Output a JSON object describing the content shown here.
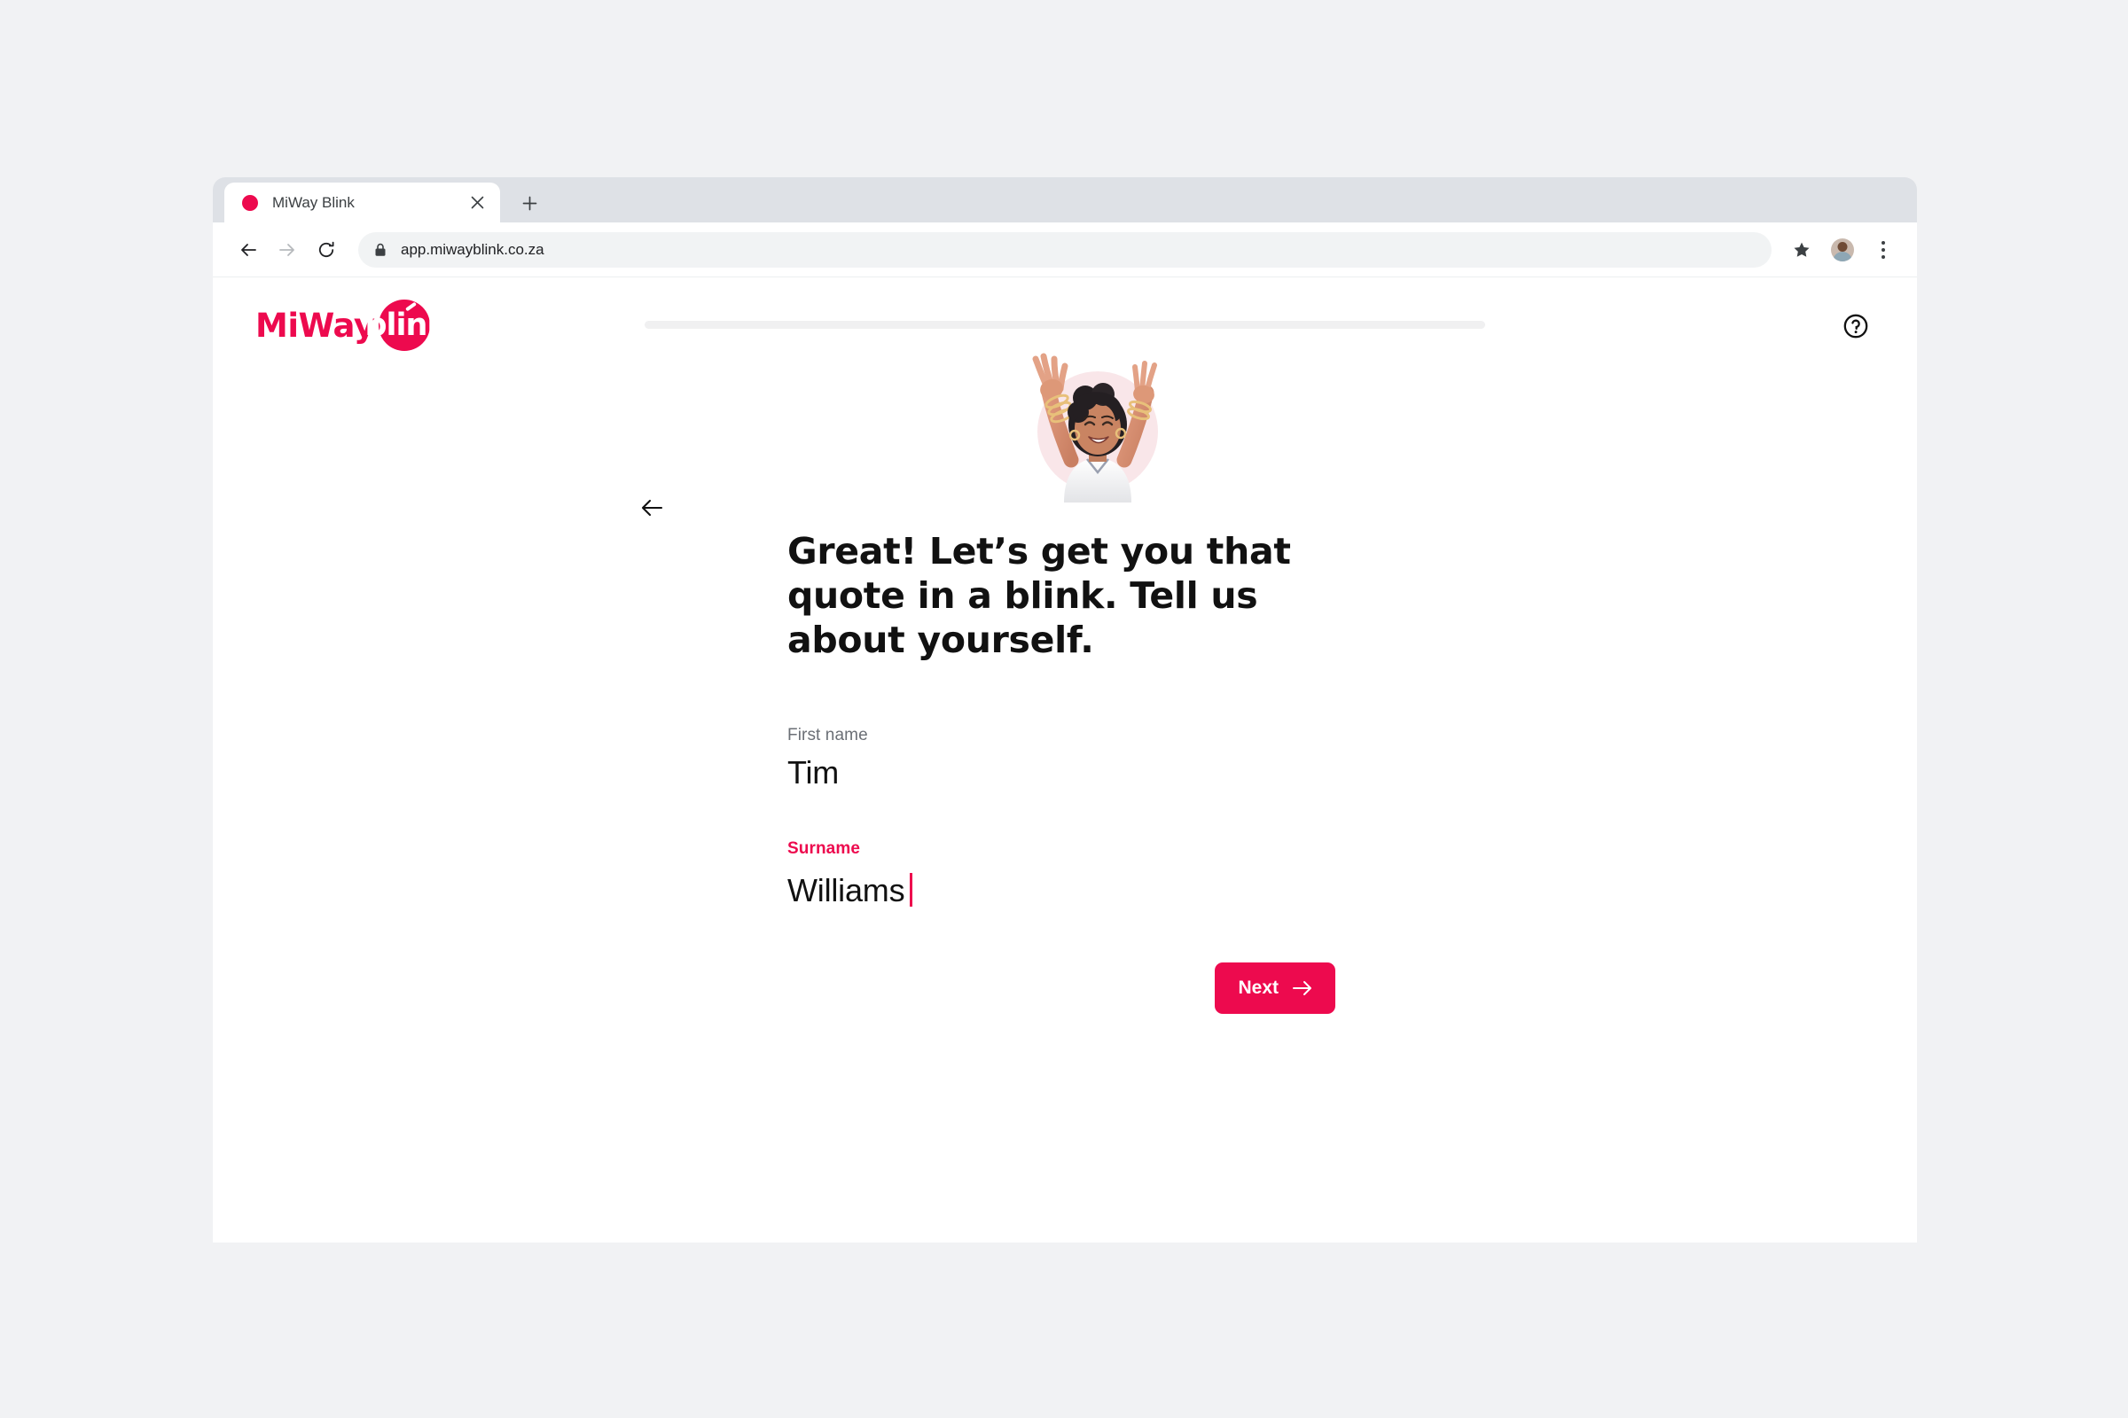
{
  "browser": {
    "tab": {
      "title": "MiWay Blink",
      "favicon_name": "miway-favicon",
      "close_label": "×"
    },
    "new_tab_label": "+",
    "toolbar": {
      "back_label": "←",
      "forward_label": "→",
      "reload_label": "⟳",
      "url": "app.miwayblink.co.za",
      "lock_name": "lock-icon",
      "bookmark_name": "star-icon",
      "profile_name": "profile-avatar",
      "menu_name": "kebab-menu-icon"
    }
  },
  "page": {
    "brand": {
      "word_one": "MiWay",
      "word_two": "blink"
    },
    "progress": {
      "percent": 0,
      "label": "0%"
    },
    "help_label": "?",
    "back_label": "←",
    "hero_name": "celebrating-woman-illustration",
    "headline": "Great! Let’s get you that quote in a blink. Tell us about yourself.",
    "fields": [
      {
        "id": "first-name",
        "label": "First name",
        "value": "Tim",
        "placeholder": "First name",
        "active": false
      },
      {
        "id": "surname",
        "label": "Surname",
        "value": "Williams",
        "placeholder": "Surname",
        "active": true
      }
    ],
    "next_button": {
      "label": "Next",
      "arrow": "→"
    },
    "colors": {
      "brand": "#ED0A4E",
      "text": "#111111",
      "label_muted": "#6b6f76",
      "hero_backdrop": "#F9E6E9"
    }
  }
}
